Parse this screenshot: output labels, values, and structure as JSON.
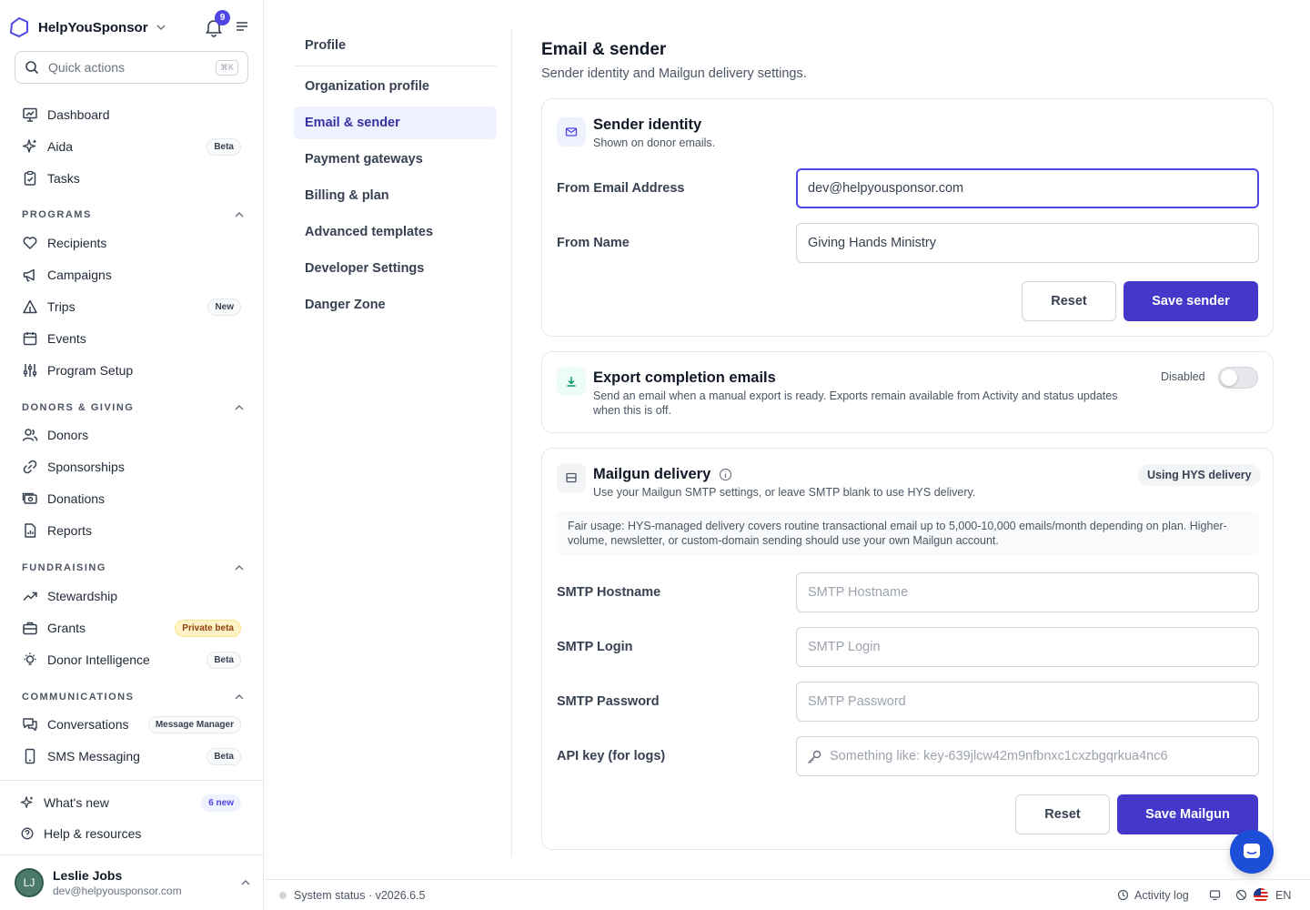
{
  "app": {
    "name": "HelpYouSponsor",
    "notifications_count": "9",
    "accent": "#4f46e5"
  },
  "sidebar": {
    "quick_actions": {
      "label": "Quick actions",
      "shortcut": "⌘K"
    },
    "top_items": [
      {
        "label": "Dashboard",
        "icon": "dashboard-icon"
      },
      {
        "label": "Aida",
        "icon": "sparkle-icon",
        "badge": "Beta"
      },
      {
        "label": "Tasks",
        "icon": "clipboard-icon"
      }
    ],
    "sections": {
      "programs": {
        "title": "PROGRAMS",
        "items": [
          {
            "label": "Recipients",
            "icon": "heart-icon"
          },
          {
            "label": "Campaigns",
            "icon": "megaphone-icon"
          },
          {
            "label": "Trips",
            "icon": "tent-icon",
            "badge": "New"
          },
          {
            "label": "Events",
            "icon": "calendar-icon"
          },
          {
            "label": "Program Setup",
            "icon": "sliders-icon"
          }
        ]
      },
      "donors": {
        "title": "DONORS & GIVING",
        "items": [
          {
            "label": "Donors",
            "icon": "users-icon"
          },
          {
            "label": "Sponsorships",
            "icon": "link-icon"
          },
          {
            "label": "Donations",
            "icon": "money-icon"
          },
          {
            "label": "Reports",
            "icon": "report-icon"
          }
        ]
      },
      "fundraising": {
        "title": "FUNDRAISING",
        "items": [
          {
            "label": "Stewardship",
            "icon": "trend-icon"
          },
          {
            "label": "Grants",
            "icon": "briefcase-icon",
            "badge": "Private beta"
          },
          {
            "label": "Donor Intelligence",
            "icon": "bulb-icon",
            "badge": "Beta"
          }
        ]
      },
      "communications": {
        "title": "COMMUNICATIONS",
        "items": [
          {
            "label": "Conversations",
            "icon": "chat-icon",
            "badge": "Message Manager"
          },
          {
            "label": "SMS Messaging",
            "icon": "phone-icon",
            "badge": "Beta"
          }
        ]
      }
    },
    "bottom_items": [
      {
        "label": "What's new",
        "icon": "sparkle-icon",
        "badge": "6 new"
      },
      {
        "label": "Help & resources",
        "icon": "help-icon"
      }
    ],
    "user": {
      "initials": "LJ",
      "name": "Leslie Jobs",
      "email": "dev@helpyousponsor.com"
    }
  },
  "settings_nav": {
    "items": [
      "Profile",
      "Organization profile",
      "Email & sender",
      "Payment gateways",
      "Billing & plan",
      "Advanced templates",
      "Developer Settings",
      "Danger Zone"
    ],
    "active": "Email & sender"
  },
  "page": {
    "title": "Email & sender",
    "subtitle": "Sender identity and Mailgun delivery settings."
  },
  "sender": {
    "title": "Sender identity",
    "desc": "Shown on donor emails.",
    "from_email_label": "From Email Address",
    "from_email_value": "dev@helpyousponsor.com",
    "from_name_label": "From Name",
    "from_name_value": "Giving Hands Ministry",
    "reset": "Reset",
    "save": "Save sender"
  },
  "export": {
    "title": "Export completion emails",
    "desc": "Send an email when a manual export is ready. Exports remain available from Activity and status updates when this is off.",
    "toggle_label": "Disabled",
    "enabled": false
  },
  "mailgun": {
    "title": "Mailgun delivery",
    "desc": "Use your Mailgun SMTP settings, or leave SMTP blank to use HYS delivery.",
    "status": "Using HYS delivery",
    "note": "Fair usage: HYS-managed delivery covers routine transactional email up to 5,000-10,000 emails/month depending on plan. Higher-volume, newsletter, or custom-domain sending should use your own Mailgun account.",
    "fields": [
      {
        "label": "SMTP Hostname",
        "placeholder": "SMTP Hostname"
      },
      {
        "label": "SMTP Login",
        "placeholder": "SMTP Login"
      },
      {
        "label": "SMTP Password",
        "placeholder": "SMTP Password"
      },
      {
        "label": "API key (for logs)",
        "placeholder": "Something like: key-639jlcw42m9nfbnxc1cxzbgqrkua4nc6"
      }
    ],
    "reset": "Reset",
    "save": "Save Mailgun"
  },
  "footer": {
    "status": "System status · v2026.6.5",
    "activity_log": "Activity log",
    "language": "EN"
  }
}
